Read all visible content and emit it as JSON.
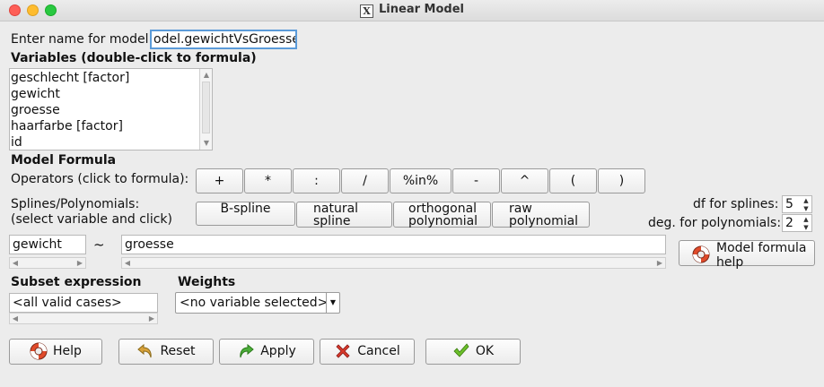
{
  "window": {
    "title": "Linear Model"
  },
  "model_name": {
    "label": "Enter name for model:",
    "value": "odel.gewichtVsGroesse"
  },
  "variables": {
    "heading": "Variables (double-click to formula)",
    "items": [
      "geschlecht [factor]",
      "gewicht",
      "groesse",
      "haarfarbe [factor]",
      "id"
    ]
  },
  "formula_section": {
    "heading": "Model Formula",
    "operators_label": "Operators (click to formula):",
    "operators": [
      "+",
      "*",
      ":",
      "/",
      "%in%",
      "-",
      "^",
      "(",
      ")"
    ],
    "splines_label_1": "Splines/Polynomials:",
    "splines_label_2": "(select variable and click)",
    "spline_buttons": [
      {
        "line1": "B-spline",
        "line2": ""
      },
      {
        "line1": "natural",
        "line2": "spline"
      },
      {
        "line1": "orthogonal",
        "line2": "polynomial"
      },
      {
        "line1": "raw",
        "line2": "polynomial"
      }
    ],
    "df_splines_label": "df for splines:",
    "df_splines_value": "5",
    "deg_poly_label": "deg. for polynomials:",
    "deg_poly_value": "2",
    "lhs_value": "gewicht",
    "tilde": "~",
    "rhs_value": "groesse",
    "formula_help_line1": "Model formula",
    "formula_help_line2": "help"
  },
  "subset": {
    "heading": "Subset expression",
    "value": "<all valid cases>"
  },
  "weights": {
    "heading": "Weights",
    "value": "<no variable selected>"
  },
  "buttons": {
    "help": "Help",
    "reset": "Reset",
    "apply": "Apply",
    "cancel": "Cancel",
    "ok": "OK"
  },
  "colors": {
    "focus_border": "#5b9bd9",
    "window_bg": "#ececec"
  }
}
